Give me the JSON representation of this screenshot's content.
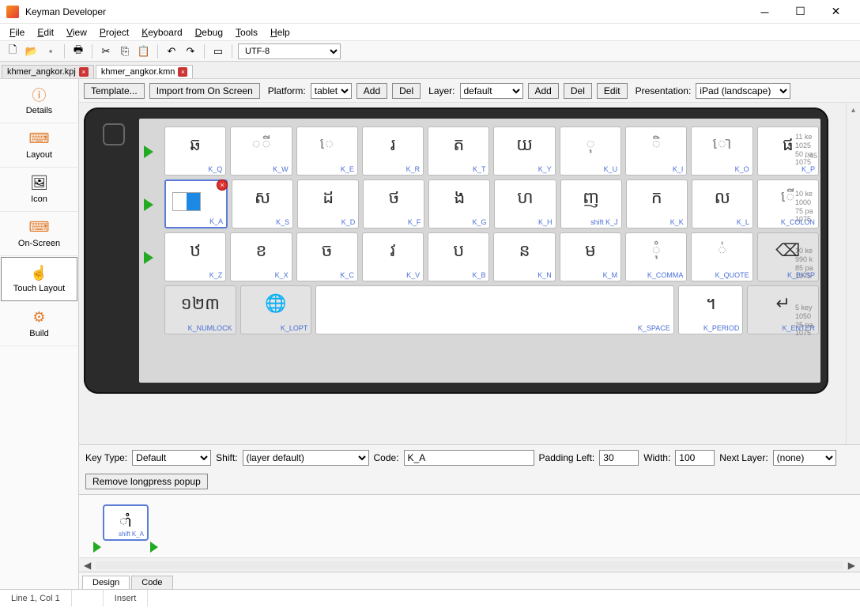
{
  "window": {
    "title": "Keyman Developer"
  },
  "menu": [
    "File",
    "Edit",
    "View",
    "Project",
    "Keyboard",
    "Debug",
    "Tools",
    "Help"
  ],
  "toolbar": {
    "encoding": "UTF-8"
  },
  "filetabs": [
    {
      "name": "khmer_angkor.kpj",
      "active": false
    },
    {
      "name": "khmer_angkor.kmn",
      "active": true
    }
  ],
  "sidebar": [
    {
      "label": "Details",
      "icon": "ℹ"
    },
    {
      "label": "Layout",
      "icon": "⌨"
    },
    {
      "label": "Icon",
      "icon": "🖼"
    },
    {
      "label": "On-Screen",
      "icon": "⌨"
    },
    {
      "label": "Touch Layout",
      "icon": "☝",
      "active": true
    },
    {
      "label": "Build",
      "icon": "⚙"
    }
  ],
  "ctrlbar": {
    "template": "Template...",
    "import": "Import from On Screen",
    "platform_label": "Platform:",
    "platform_value": "tablet",
    "add": "Add",
    "del": "Del",
    "layer_label": "Layer:",
    "layer_value": "default",
    "edit": "Edit",
    "presentation_label": "Presentation:",
    "presentation_value": "iPad (landscape)"
  },
  "keyboard": {
    "rows": [
      {
        "info": "11 ke\n1025\n50 pa\n1075",
        "keys": [
          {
            "glyph": "ឆ",
            "code": "K_Q"
          },
          {
            "glyph": "◌឵ី",
            "code": "K_W",
            "dot": true
          },
          {
            "glyph": "េ",
            "code": "K_E",
            "dot": true
          },
          {
            "glyph": "រ",
            "code": "K_R"
          },
          {
            "glyph": "ត",
            "code": "K_T"
          },
          {
            "glyph": "យ",
            "code": "K_Y"
          },
          {
            "glyph": "◌ុ",
            "code": "K_U",
            "dot": true
          },
          {
            "glyph": "◌ិ",
            "code": "K_I",
            "dot": true
          },
          {
            "glyph": "ោ",
            "code": "K_O",
            "dot": true
          },
          {
            "glyph": "ផ",
            "code": "K_P"
          }
        ]
      },
      {
        "info": "10 ke\n1000\n75 pa\n1075",
        "keys": [
          {
            "glyph": "",
            "code": "K_A",
            "selected": true
          },
          {
            "glyph": "ស",
            "code": "K_S"
          },
          {
            "glyph": "ដ",
            "code": "K_D"
          },
          {
            "glyph": "ថ",
            "code": "K_F"
          },
          {
            "glyph": "ង",
            "code": "K_G"
          },
          {
            "glyph": "ហ",
            "code": "K_H"
          },
          {
            "glyph": "ញ",
            "code": "shift K_J"
          },
          {
            "glyph": "ក",
            "code": "K_K"
          },
          {
            "glyph": "ល",
            "code": "K_L"
          },
          {
            "glyph": "ើ",
            "code": "K_COLON",
            "dot": true
          }
        ]
      },
      {
        "info": "10 ke\n990 k\n85 pa\n1075",
        "keys": [
          {
            "glyph": "ឋ",
            "code": "K_Z"
          },
          {
            "glyph": "ខ",
            "code": "K_X"
          },
          {
            "glyph": "ច",
            "code": "K_C"
          },
          {
            "glyph": "វ",
            "code": "K_V"
          },
          {
            "glyph": "ប",
            "code": "K_B"
          },
          {
            "glyph": "ន",
            "code": "K_N"
          },
          {
            "glyph": "ម",
            "code": "K_M"
          },
          {
            "glyph": "◌ុំ",
            "code": "K_COMMA",
            "dot": true
          },
          {
            "glyph": "◌់",
            "code": "K_QUOTE",
            "dot": true
          },
          {
            "glyph": "⌫",
            "code": "K_BKSP",
            "special": true
          }
        ]
      },
      {
        "info": "5 key\n1050\n25 pa\n1075",
        "keys": [
          {
            "glyph": "១២៣",
            "code": "K_NUMLOCK",
            "special": true,
            "w": 1.1
          },
          {
            "glyph": "🌐",
            "code": "K_LOPT",
            "special": true,
            "w": 1.1
          },
          {
            "glyph": "",
            "code": "K_SPACE",
            "w": 5.6
          },
          {
            "glyph": "។",
            "code": "K_PERIOD",
            "w": 1
          },
          {
            "glyph": "↵",
            "code": "K_ENTER",
            "special": true,
            "w": 1.1
          }
        ]
      }
    ],
    "clock": ":45"
  },
  "props": {
    "keytype_label": "Key Type:",
    "keytype_value": "Default",
    "shift_label": "Shift:",
    "shift_value": "(layer default)",
    "code_label": "Code:",
    "code_value": "K_A",
    "padleft_label": "Padding Left:",
    "padleft_value": "30",
    "width_label": "Width:",
    "width_value": "100",
    "nextlayer_label": "Next Layer:",
    "nextlayer_value": "(none)",
    "remove_longpress": "Remove longpress popup"
  },
  "longpress": {
    "glyph": "ាំ",
    "code": "shift K_A"
  },
  "bottomtabs": {
    "design": "Design",
    "code": "Code"
  },
  "status": {
    "pos": "Line 1, Col 1",
    "mode": "Insert"
  }
}
